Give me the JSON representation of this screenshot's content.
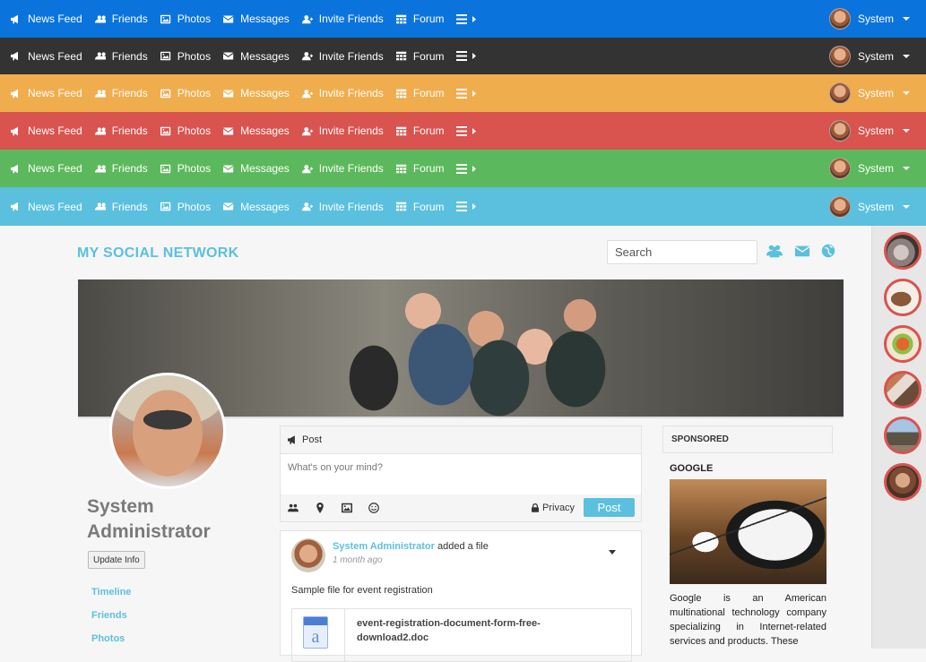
{
  "navbars": [
    {
      "name": "blue",
      "items": [
        "News Feed",
        "Friends",
        "Photos",
        "Messages",
        "Invite Friends",
        "Forum"
      ],
      "user": "System"
    },
    {
      "name": "dark",
      "items": [
        "News Feed",
        "Friends",
        "Photos",
        "Messages",
        "Invite Friends",
        "Forum"
      ],
      "user": "System"
    },
    {
      "name": "orange",
      "items": [
        "News Feed",
        "Friends",
        "Photos",
        "Messages",
        "Invite Friends",
        "Forum"
      ],
      "user": "System"
    },
    {
      "name": "red",
      "items": [
        "News Feed",
        "Friends",
        "Photos",
        "Messages",
        "Invite Friends",
        "Forum"
      ],
      "user": "System"
    },
    {
      "name": "green",
      "items": [
        "News Feed",
        "Friends",
        "Photos",
        "Messages",
        "Invite Friends",
        "Forum"
      ],
      "user": "System"
    },
    {
      "name": "cyan",
      "items": [
        "News Feed",
        "Friends",
        "Photos",
        "Messages",
        "Invite Friends",
        "Forum"
      ],
      "user": "System"
    }
  ],
  "nav_icons": [
    "bullhorn-icon",
    "users-icon",
    "image-icon",
    "envelope-icon",
    "user-plus-icon",
    "table-icon",
    "bars-icon"
  ],
  "colors": {
    "blue": "#0b74dc",
    "dark": "#333333",
    "orange": "#f0ad4e",
    "red": "#d9534f",
    "green": "#5cb85c",
    "cyan": "#5bc0de"
  },
  "header": {
    "brand": "MY SOCIAL NETWORK",
    "search_placeholder": "Search",
    "icons": [
      "users-icon",
      "envelope-icon",
      "globe-icon"
    ]
  },
  "profile": {
    "name": "System Administrator",
    "update_button": "Update Info",
    "links": [
      "Timeline",
      "Friends",
      "Photos"
    ]
  },
  "composer": {
    "title": "Post",
    "placeholder": "What's on your mind?",
    "privacy": "Privacy",
    "post_button": "Post",
    "tools": [
      "users-icon",
      "map-marker-icon",
      "image-icon",
      "smile-icon"
    ]
  },
  "feed": {
    "author": "System Administrator",
    "action": "added a file",
    "time": "1 month ago",
    "text": "Sample file for event registration",
    "file_name": "event-registration-document-form-free-download2.doc"
  },
  "sponsored": {
    "heading": "SPONSORED",
    "title": "GOOGLE",
    "text": "Google is an American multinational technology company specializing in Internet-related services and products. These"
  }
}
